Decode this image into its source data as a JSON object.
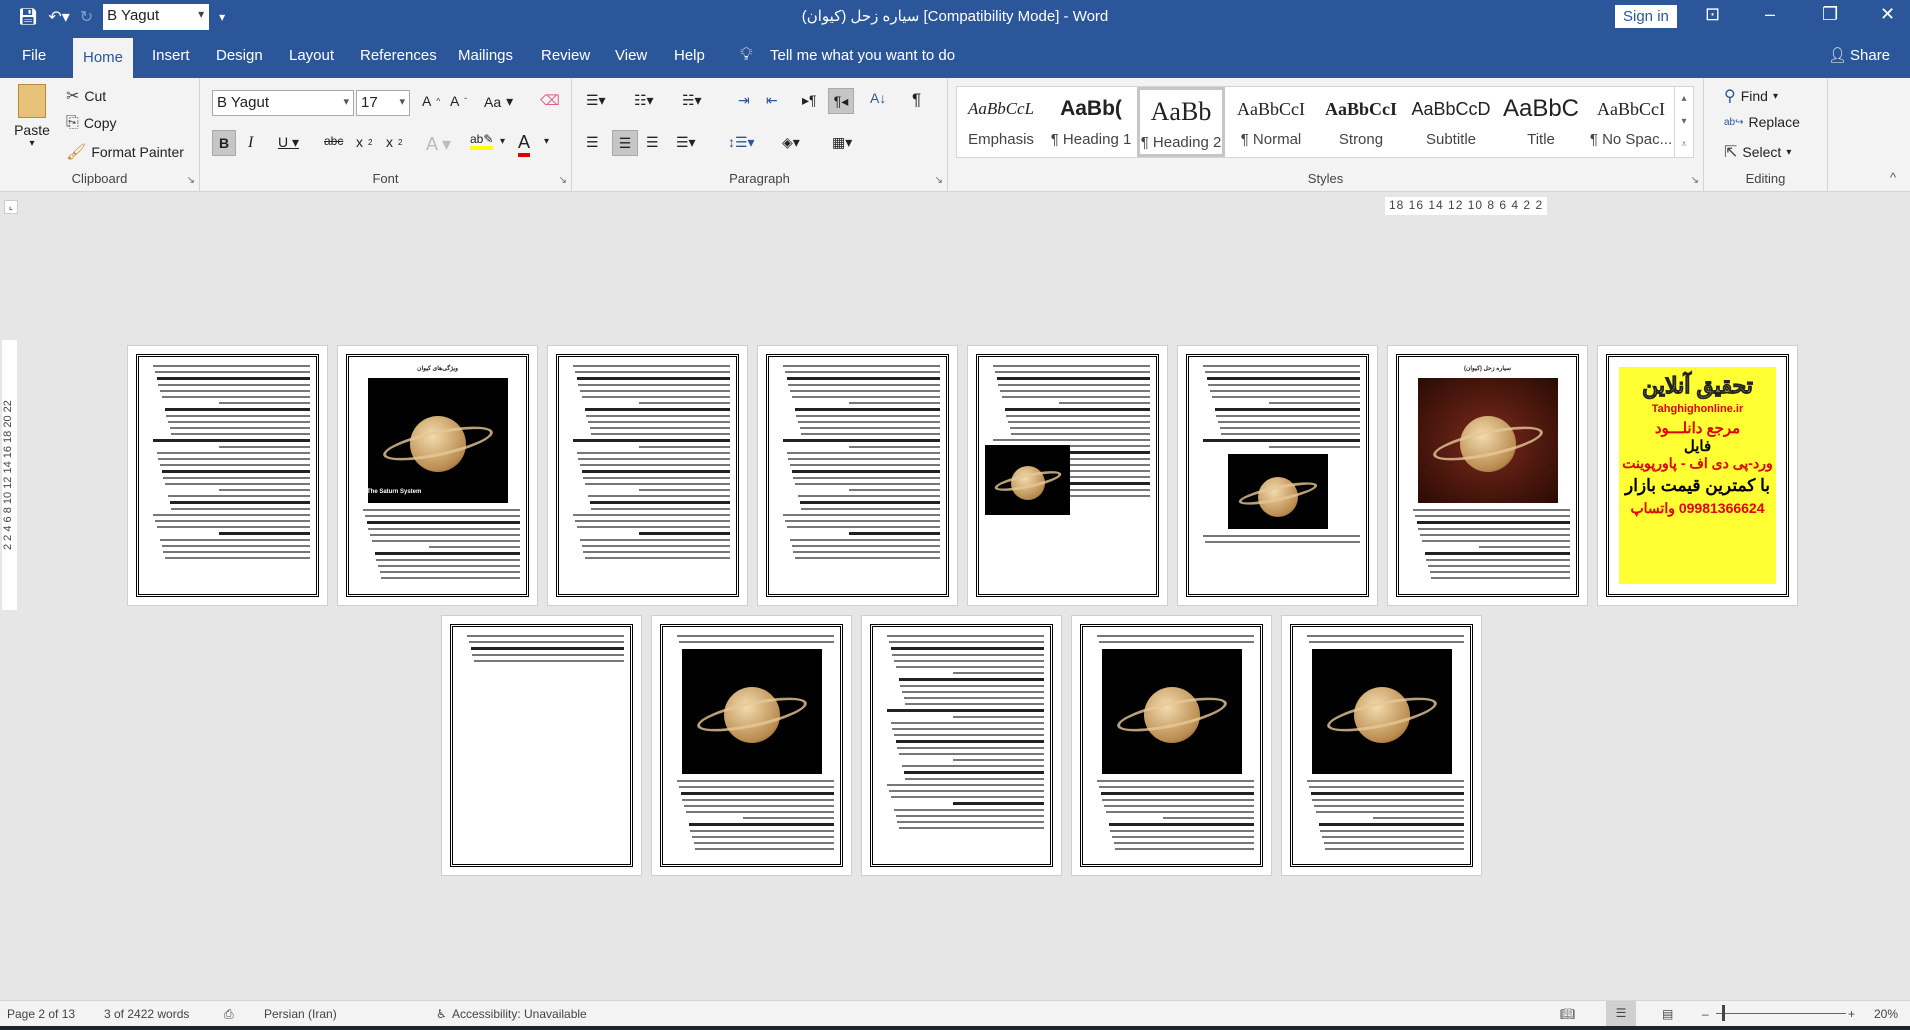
{
  "titlebar": {
    "font_name": "B Yagut",
    "title": "سیاره زحل (کیوان) [Compatibility Mode]  -  Word",
    "sign_in": "Sign in"
  },
  "tabs": [
    "File",
    "Home",
    "Insert",
    "Design",
    "Layout",
    "References",
    "Mailings",
    "Review",
    "View",
    "Help"
  ],
  "tell_me": "Tell me what you want to do",
  "share": "Share",
  "clipboard": {
    "paste": "Paste",
    "cut": "Cut",
    "copy": "Copy",
    "format_painter": "Format Painter",
    "label": "Clipboard"
  },
  "font": {
    "name": "B Yagut",
    "size": "17",
    "label": "Font",
    "change_case": "Aa"
  },
  "paragraph": {
    "label": "Paragraph"
  },
  "styles": {
    "label": "Styles",
    "items": [
      {
        "preview": "AaBbCcL",
        "name": "Emphasis"
      },
      {
        "preview": "AaBb(",
        "name": "¶ Heading 1"
      },
      {
        "preview": "AaBb",
        "name": "¶ Heading 2",
        "selected": true
      },
      {
        "preview": "AaBbCcI",
        "name": "¶ Normal"
      },
      {
        "preview": "AaBbCcI",
        "name": "Strong"
      },
      {
        "preview": "AaBbCcD",
        "name": "Subtitle"
      },
      {
        "preview": "AaBbC",
        "name": "Title"
      },
      {
        "preview": "AaBbCcI",
        "name": "¶ No Spac..."
      }
    ]
  },
  "editing": {
    "find": "Find",
    "replace": "Replace",
    "select": "Select",
    "label": "Editing"
  },
  "ruler": "18 16 14 12 10 8 6 4 2   2",
  "vruler": "2  2  4  6  8  10  12  14  16  18  20  22",
  "pages": [
    {
      "type": "text"
    },
    {
      "type": "image",
      "heading": "ویژگی‌های کیوان",
      "caption": "The Saturn System"
    },
    {
      "type": "text"
    },
    {
      "type": "text"
    },
    {
      "type": "image-left"
    },
    {
      "type": "image-mid"
    },
    {
      "type": "image",
      "heading": "سیاره زحل (کیوان)"
    },
    {
      "type": "ad",
      "ad": {
        "title": "تحقیق آنلاین",
        "site": "Tahghighonline.ir",
        "l1": "مرجع دانلـــود",
        "l2": "فایل",
        "l3": "ورد-پی دی اف - پاورپوینت",
        "l4": "با کمترین قیمت بازار",
        "l5": "09981366624 واتساپ"
      }
    },
    {
      "type": "short"
    },
    {
      "type": "image"
    },
    {
      "type": "text"
    },
    {
      "type": "image"
    },
    {
      "type": "image"
    }
  ],
  "status": {
    "page": "Page 2 of 13",
    "words": "3 of 2422 words",
    "language": "Persian (Iran)",
    "accessibility": "Accessibility: Unavailable",
    "zoom": "20%",
    "zoom_level_percent": 20
  },
  "colors": {
    "accent": "#2b579a"
  }
}
